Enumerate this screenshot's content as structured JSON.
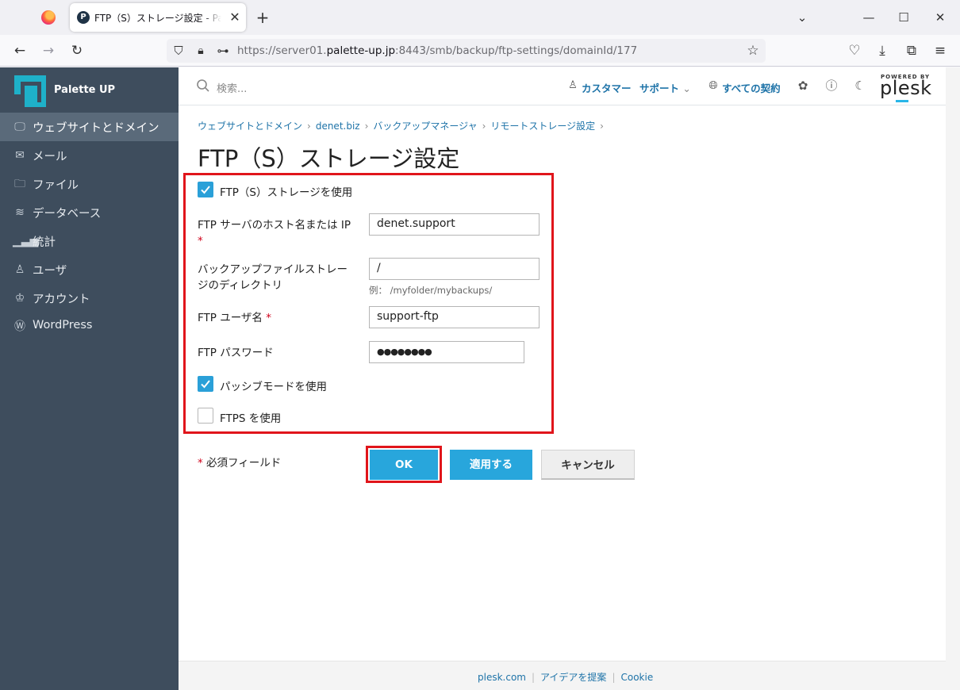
{
  "browser": {
    "tab_title": "FTP（S）ストレージ設定 - Palette UP",
    "tab_favicon_letter": "P",
    "url_prefix": "https://server01.",
    "url_host": "palette-up.jp",
    "url_path": ":8443/smb/backup/ftp-settings/domainId/177"
  },
  "sidebar": {
    "brand": "Palette UP",
    "items": [
      {
        "label": "ウェブサイトとドメイン",
        "icon": "monitor-icon",
        "active": true
      },
      {
        "label": "メール",
        "icon": "mail-icon"
      },
      {
        "label": "ファイル",
        "icon": "folder-icon"
      },
      {
        "label": "データベース",
        "icon": "database-icon"
      },
      {
        "label": "統計",
        "icon": "chart-icon"
      },
      {
        "label": "ユーザ",
        "icon": "user-icon"
      },
      {
        "label": "アカウント",
        "icon": "crown-icon"
      },
      {
        "label": "WordPress",
        "icon": "wordpress-icon"
      }
    ]
  },
  "header": {
    "search_placeholder": "検索...",
    "customer": "カスタマー",
    "support": "サポート",
    "all_subscriptions": "すべての契約",
    "powered_by": "POWERED BY",
    "plesk": "plesk"
  },
  "breadcrumb": [
    "ウェブサイトとドメイン",
    "denet.biz",
    "バックアップマネージャ",
    "リモートストレージ設定"
  ],
  "page_title": "FTP（S）ストレージ設定",
  "form": {
    "use_storage_label": "FTP（S）ストレージを使用",
    "use_storage_checked": true,
    "host_label": "FTP サーバのホスト名または IP",
    "host_value": "denet.support",
    "dir_label": "バックアップファイルストレージのディレクトリ",
    "dir_value": "/",
    "dir_hint": "例： /myfolder/mybackups/",
    "user_label": "FTP ユーザ名",
    "user_value": "support-ftp",
    "password_label": "FTP パスワード",
    "password_value": "●●●●●●●●",
    "passive_label": "パッシブモードを使用",
    "passive_checked": true,
    "ftps_label": "FTPS を使用",
    "ftps_checked": false,
    "required_marker": "*",
    "required_note": "必須フィールド"
  },
  "buttons": {
    "ok": "OK",
    "apply": "適用する",
    "cancel": "キャンセル"
  },
  "footer": [
    "plesk.com",
    "アイデアを提案",
    "Cookie"
  ],
  "colors": {
    "sidebar": "#3e4d5d",
    "accent": "#28a6dc",
    "link": "#1e73a8",
    "highlight": "#e0151b"
  }
}
